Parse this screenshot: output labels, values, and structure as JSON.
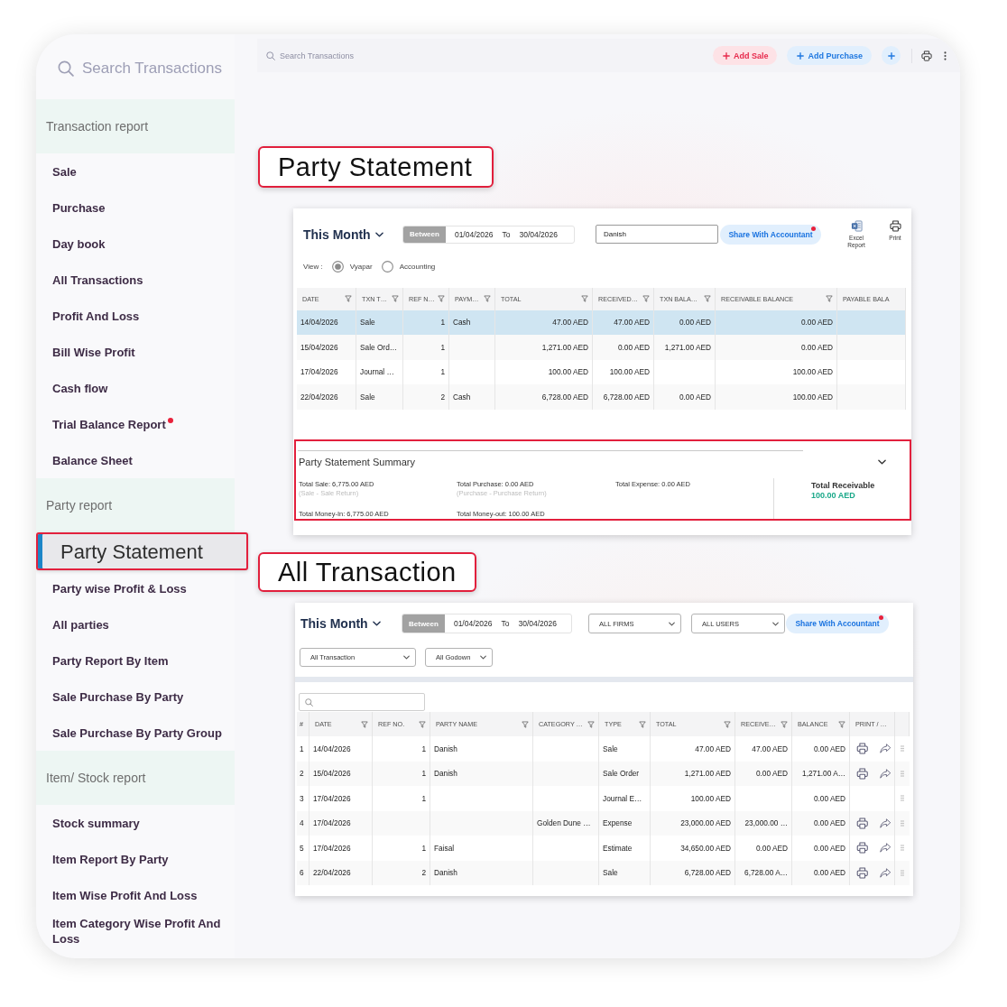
{
  "sidebar": {
    "search": {
      "placeholder": "Search Transactions"
    },
    "sections": [
      {
        "title": "Transaction report",
        "items": [
          {
            "label": "Sale",
            "selected": false,
            "dot": false
          },
          {
            "label": "Purchase",
            "selected": false,
            "dot": false
          },
          {
            "label": "Day book",
            "selected": false,
            "dot": false
          },
          {
            "label": "All Transactions",
            "selected": false,
            "dot": false
          },
          {
            "label": "Profit And Loss",
            "selected": false,
            "dot": false
          },
          {
            "label": "Bill Wise Profit",
            "selected": false,
            "dot": false
          },
          {
            "label": "Cash flow",
            "selected": false,
            "dot": false
          },
          {
            "label": "Trial Balance Report",
            "selected": false,
            "dot": true
          },
          {
            "label": "Balance Sheet",
            "selected": false,
            "dot": false
          }
        ]
      },
      {
        "title": "Party report",
        "items": [
          {
            "label": "Party Statement",
            "selected": true,
            "dot": false
          },
          {
            "label": "Party wise Profit & Loss",
            "selected": false,
            "dot": false
          },
          {
            "label": "All parties",
            "selected": false,
            "dot": false
          },
          {
            "label": "Party Report By Item",
            "selected": false,
            "dot": false
          },
          {
            "label": "Sale Purchase By Party",
            "selected": false,
            "dot": false
          },
          {
            "label": "Sale Purchase By Party Group",
            "selected": false,
            "dot": false
          }
        ]
      },
      {
        "title": "Item/ Stock report",
        "items": [
          {
            "label": "Stock summary",
            "selected": false,
            "dot": false
          },
          {
            "label": "Item Report By Party",
            "selected": false,
            "dot": false
          },
          {
            "label": "Item Wise Profit And Loss",
            "selected": false,
            "dot": false
          },
          {
            "label": "Item Category Wise Profit And Loss",
            "selected": false,
            "dot": false
          }
        ]
      }
    ]
  },
  "top_bar": {
    "search": {
      "placeholder": "Search Transactions"
    },
    "buttons": [
      {
        "kind": "sale",
        "label": "Add Sale"
      },
      {
        "kind": "purchase",
        "label": "Add Purchase"
      },
      {
        "kind": "add"
      }
    ]
  },
  "party_statement": {
    "callout": "Party Statement",
    "period": "This Month",
    "date_range": {
      "label": "Between",
      "from": "01/04/2026",
      "to_label": "To",
      "to": "30/04/2026"
    },
    "party": {
      "value": "Danish"
    },
    "share": {
      "label": "Share With Accountant",
      "dot": true
    },
    "actions": [
      {
        "kind": "excel",
        "label": "Excel Report"
      },
      {
        "kind": "print",
        "label": "Print"
      }
    ],
    "view": {
      "label": "View :",
      "options": [
        {
          "label": "Vyapar",
          "selected": true
        },
        {
          "label": "Accounting",
          "selected": false
        }
      ]
    },
    "table": {
      "columns": [
        {
          "label": "DATE",
          "filter": true
        },
        {
          "label": "TXN T…",
          "filter": true
        },
        {
          "label": "REF N…",
          "filter": true
        },
        {
          "label": "PAYM…",
          "filter": true
        },
        {
          "label": "TOTAL",
          "filter": true
        },
        {
          "label": "RECEIVED…",
          "filter": true
        },
        {
          "label": "TXN BALA…",
          "filter": true
        },
        {
          "label": "RECEIVABLE BALANCE",
          "filter": true
        },
        {
          "label": "PAYABLE BALA",
          "filter": false
        }
      ],
      "rows": [
        {
          "selected": true,
          "cells": [
            "14/04/2026",
            "Sale",
            "1",
            "Cash",
            "47.00 AED",
            "47.00 AED",
            "0.00 AED",
            "0.00 AED"
          ]
        },
        {
          "selected": false,
          "cells": [
            "15/04/2026",
            "Sale Ord…",
            "1",
            null,
            "1,271.00 AED",
            "0.00 AED",
            "1,271.00 AED",
            "0.00 AED"
          ]
        },
        {
          "selected": false,
          "cells": [
            "17/04/2026",
            "Journal …",
            "1",
            null,
            "100.00 AED",
            "100.00 AED",
            null,
            "100.00 AED"
          ]
        },
        {
          "selected": false,
          "cells": [
            "22/04/2026",
            "Sale",
            "2",
            "Cash",
            "6,728.00 AED",
            "6,728.00 AED",
            "0.00 AED",
            "100.00 AED"
          ]
        }
      ]
    },
    "summary": {
      "title": "Party Statement Summary",
      "items": [
        {
          "label": "Total Sale: 6,775.00 AED",
          "note": "(Sale - Sale Return)"
        },
        {
          "label": "Total Purchase: 0.00 AED",
          "note": "(Purchase - Purchase Return)"
        },
        {
          "label": "Total Expense: 0.00 AED"
        },
        {
          "label": "Total Money-In: 6,775.00 AED"
        },
        {
          "label": "Total Money-out: 100.00 AED"
        }
      ],
      "total": {
        "label": "Total Receivable",
        "value": "100.00 AED"
      }
    }
  },
  "all_transaction": {
    "callout": "All Transaction",
    "period": "This Month",
    "date_range": {
      "label": "Between",
      "from": "01/04/2026",
      "to_label": "To",
      "to": "30/04/2026"
    },
    "selects": [
      "ALL FIRMS",
      "ALL USERS"
    ],
    "share": {
      "label": "Share With Accountant",
      "dot": true
    },
    "filters": [
      "All Transaction",
      "All Godown"
    ],
    "table": {
      "columns": [
        {
          "label": "#",
          "filter": false
        },
        {
          "label": "DATE",
          "filter": true
        },
        {
          "label": "REF NO.",
          "filter": true
        },
        {
          "label": "PARTY NAME",
          "filter": true
        },
        {
          "label": "CATEGORY …",
          "filter": true
        },
        {
          "label": "TYPE",
          "filter": true
        },
        {
          "label": "TOTAL",
          "filter": true
        },
        {
          "label": "RECEIVE…",
          "filter": true
        },
        {
          "label": "BALANCE",
          "filter": true
        },
        {
          "label": "PRINT / …",
          "filter": false
        }
      ],
      "rows": [
        {
          "cells": [
            "1",
            "14/04/2026",
            "1",
            "Danish",
            null,
            "Sale",
            "47.00 AED",
            "47.00 AED",
            "0.00 AED"
          ],
          "actions": true
        },
        {
          "cells": [
            "2",
            "15/04/2026",
            "1",
            "Danish",
            null,
            "Sale Order",
            "1,271.00 AED",
            "0.00 AED",
            "1,271.00 A…"
          ],
          "actions": true
        },
        {
          "cells": [
            "3",
            "17/04/2026",
            "1",
            null,
            null,
            "Journal E…",
            "100.00 AED",
            null,
            "0.00 AED"
          ],
          "actions": false
        },
        {
          "cells": [
            "4",
            "17/04/2026",
            null,
            null,
            "Golden Dune …",
            "Expense",
            "23,000.00 AED",
            "23,000.00 …",
            "0.00 AED"
          ],
          "actions": true
        },
        {
          "cells": [
            "5",
            "17/04/2026",
            "1",
            "Faisal",
            null,
            "Estimate",
            "34,650.00 AED",
            "0.00 AED",
            "0.00 AED"
          ],
          "actions": true
        },
        {
          "cells": [
            "6",
            "22/04/2026",
            "2",
            "Danish",
            null,
            "Sale",
            "6,728.00 AED",
            "6,728.00 A…",
            "0.00 AED"
          ],
          "actions": true
        }
      ]
    }
  }
}
